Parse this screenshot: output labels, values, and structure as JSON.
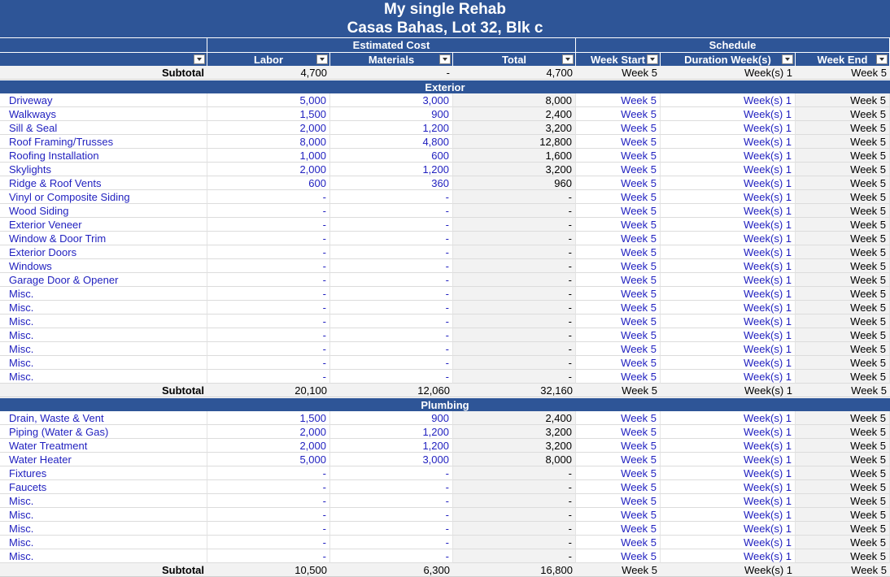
{
  "title_line1": "My single Rehab",
  "title_line2": "Casas Bahas, Lot 32, Blk c",
  "group_headers": {
    "estimated_cost": "Estimated Cost",
    "schedule": "Schedule"
  },
  "columns": {
    "labor": "Labor",
    "materials": "Materials",
    "total": "Total",
    "week_start": "Week Start",
    "duration": "Duration Week(s)",
    "week_end": "Week End"
  },
  "top_subtotal": {
    "label": "Subtotal",
    "labor": "4,700",
    "materials": "-",
    "total": "4,700",
    "week_start": "Week 5",
    "duration": "Week(s) 1",
    "week_end": "Week 5"
  },
  "sections": [
    {
      "name": "Exterior",
      "items": [
        {
          "name": "Driveway",
          "labor": "5,000",
          "materials": "3,000",
          "total": "8,000"
        },
        {
          "name": "Walkways",
          "labor": "1,500",
          "materials": "900",
          "total": "2,400"
        },
        {
          "name": "Sill & Seal",
          "labor": "2,000",
          "materials": "1,200",
          "total": "3,200"
        },
        {
          "name": "Roof Framing/Trusses",
          "labor": "8,000",
          "materials": "4,800",
          "total": "12,800"
        },
        {
          "name": "Roofing Installation",
          "labor": "1,000",
          "materials": "600",
          "total": "1,600"
        },
        {
          "name": "Skylights",
          "labor": "2,000",
          "materials": "1,200",
          "total": "3,200"
        },
        {
          "name": "Ridge & Roof Vents",
          "labor": "600",
          "materials": "360",
          "total": "960"
        },
        {
          "name": "Vinyl or Composite Siding",
          "labor": "-",
          "materials": "-",
          "total": "-"
        },
        {
          "name": "Wood Siding",
          "labor": "-",
          "materials": "-",
          "total": "-"
        },
        {
          "name": "Exterior Veneer",
          "labor": "-",
          "materials": "-",
          "total": "-"
        },
        {
          "name": "Window & Door Trim",
          "labor": "-",
          "materials": "-",
          "total": "-"
        },
        {
          "name": "Exterior Doors",
          "labor": "-",
          "materials": "-",
          "total": "-"
        },
        {
          "name": "Windows",
          "labor": "-",
          "materials": "-",
          "total": "-"
        },
        {
          "name": "Garage Door & Opener",
          "labor": "-",
          "materials": "-",
          "total": "-"
        },
        {
          "name": "Misc.",
          "labor": "-",
          "materials": "-",
          "total": "-"
        },
        {
          "name": "Misc.",
          "labor": "-",
          "materials": "-",
          "total": "-"
        },
        {
          "name": "Misc.",
          "labor": "-",
          "materials": "-",
          "total": "-"
        },
        {
          "name": "Misc.",
          "labor": "-",
          "materials": "-",
          "total": "-"
        },
        {
          "name": "Misc.",
          "labor": "-",
          "materials": "-",
          "total": "-"
        },
        {
          "name": "Misc.",
          "labor": "-",
          "materials": "-",
          "total": "-"
        },
        {
          "name": "Misc.",
          "labor": "-",
          "materials": "-",
          "total": "-"
        }
      ],
      "subtotal": {
        "label": "Subtotal",
        "labor": "20,100",
        "materials": "12,060",
        "total": "32,160",
        "week_start": "Week 5",
        "duration": "Week(s) 1",
        "week_end": "Week 5"
      }
    },
    {
      "name": "Plumbing",
      "items": [
        {
          "name": "Drain, Waste & Vent",
          "labor": "1,500",
          "materials": "900",
          "total": "2,400"
        },
        {
          "name": "Piping (Water & Gas)",
          "labor": "2,000",
          "materials": "1,200",
          "total": "3,200"
        },
        {
          "name": "Water Treatment",
          "labor": "2,000",
          "materials": "1,200",
          "total": "3,200"
        },
        {
          "name": "Water Heater",
          "labor": "5,000",
          "materials": "3,000",
          "total": "8,000"
        },
        {
          "name": "Fixtures",
          "labor": "-",
          "materials": "-",
          "total": "-"
        },
        {
          "name": "Faucets",
          "labor": "-",
          "materials": "-",
          "total": "-"
        },
        {
          "name": "Misc.",
          "labor": "-",
          "materials": "-",
          "total": "-"
        },
        {
          "name": "Misc.",
          "labor": "-",
          "materials": "-",
          "total": "-"
        },
        {
          "name": "Misc.",
          "labor": "-",
          "materials": "-",
          "total": "-"
        },
        {
          "name": "Misc.",
          "labor": "-",
          "materials": "-",
          "total": "-"
        },
        {
          "name": "Misc.",
          "labor": "-",
          "materials": "-",
          "total": "-"
        }
      ],
      "subtotal": {
        "label": "Subtotal",
        "labor": "10,500",
        "materials": "6,300",
        "total": "16,800",
        "week_start": "Week 5",
        "duration": "Week(s) 1",
        "week_end": "Week 5"
      }
    }
  ],
  "item_schedule": {
    "week_start": "Week 5",
    "duration": "Week(s) 1",
    "week_end": "Week 5"
  },
  "colors": {
    "header_bg": "#2e5597",
    "input_text": "#1f1fbf",
    "calc_bg": "#f2f2f2"
  }
}
